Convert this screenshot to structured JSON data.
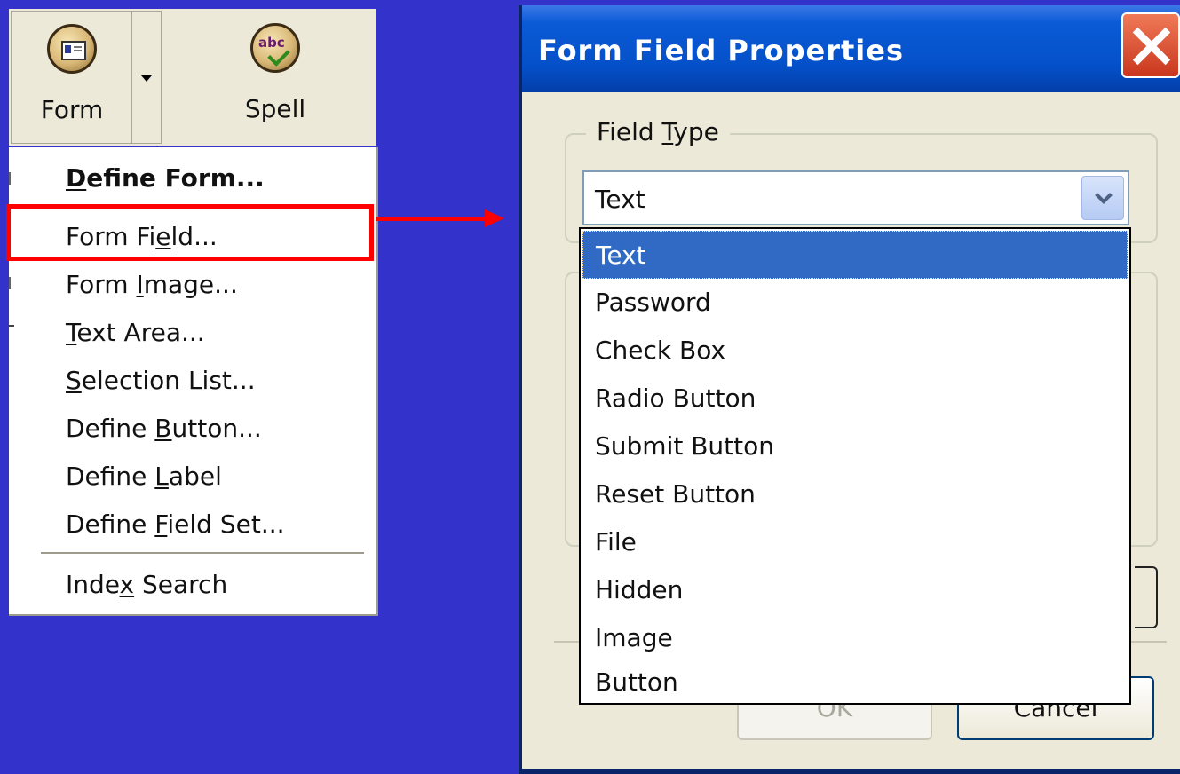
{
  "toolbar": {
    "form_label": "Form",
    "spell_label": "Spell",
    "spell_icon_text": "abc"
  },
  "menu": {
    "items": [
      {
        "pre": "",
        "u": "D",
        "post": "efine Form..."
      },
      {
        "pre": "Form Fi",
        "u": "e",
        "post": "ld..."
      },
      {
        "pre": "Form ",
        "u": "I",
        "post": "mage..."
      },
      {
        "pre": "",
        "u": "T",
        "post": "ext Area..."
      },
      {
        "pre": "",
        "u": "S",
        "post": "election List..."
      },
      {
        "pre": "Define ",
        "u": "B",
        "post": "utton..."
      },
      {
        "pre": "Define ",
        "u": "L",
        "post": "abel"
      },
      {
        "pre": "Define ",
        "u": "F",
        "post": "ield Set..."
      },
      {
        "pre": "Inde",
        "u": "x",
        "post": " Search"
      }
    ],
    "highlighted_item": "Form Field..."
  },
  "dialog": {
    "title": "Form Field Properties",
    "field_type_group": {
      "pre": "Field ",
      "u": "T",
      "post": "ype"
    },
    "field_type_value": "Text",
    "options": [
      "Text",
      "Password",
      "Check Box",
      "Radio Button",
      "Submit Button",
      "Reset Button",
      "File",
      "Hidden",
      "Image",
      "Button"
    ],
    "selected_option": "Text",
    "ok_label": "OK",
    "cancel_label": "Cancel"
  },
  "colors": {
    "background": "#3333cc",
    "highlight_border": "#ff0000",
    "titlebar": "#0450c9",
    "selection": "#316ac5"
  },
  "icons": [
    "form-icon",
    "spell-check-icon",
    "dropdown-arrow-icon",
    "close-icon",
    "combo-arrow-icon",
    "red-arrow-icon"
  ]
}
